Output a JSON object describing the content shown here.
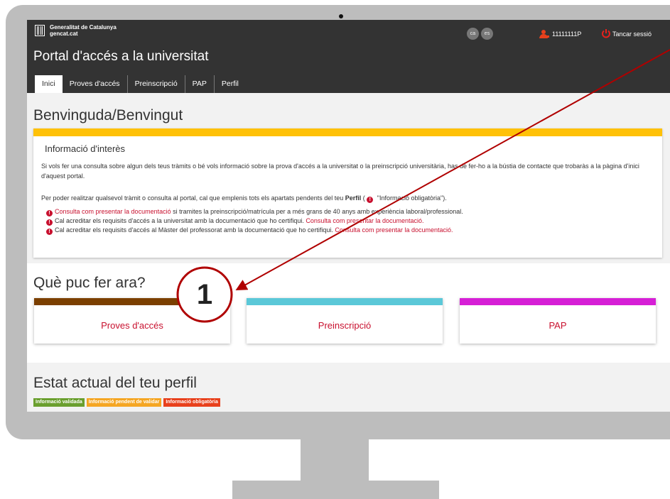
{
  "header": {
    "gov_line1": "Generalitat de Catalunya",
    "gov_line2": "gencat.cat",
    "lang_ca": "ca",
    "lang_es": "es",
    "user_id": "11111111P",
    "logout_label": "Tancar sessió",
    "portal_title": "Portal d'accés a la universitat"
  },
  "tabs": [
    {
      "label": "Inici"
    },
    {
      "label": "Proves d'accés"
    },
    {
      "label": "Preinscripció"
    },
    {
      "label": "PAP"
    },
    {
      "label": "Perfil"
    }
  ],
  "welcome_title": "Benvinguda/Benvingut",
  "info": {
    "title": "Informació d'interès",
    "para1": "Si vols fer una consulta sobre algun dels teus tràmits o bé vols informació sobre la prova d'accés a la universitat o la preinscripció universitària, has de fer-ho a la bústia de contacte que trobaràs a la pàgina d'inici d'aquest portal.",
    "para2_prefix": "Per poder realitzar qualsevol tràmit o consulta al portal, cal que emplenis tots els apartats pendents del teu ",
    "para2_bold": "Perfil",
    "para2_mid": " ( ",
    "para2_suffix": " \"Informació obligatòria\").",
    "bullet1_link": "Consulta com presentar la documentació",
    "bullet1_text": " si tramites la preinscripció/matrícula per a més grans de 40 anys amb experiència laboral/professional.",
    "bullet2_text": "Cal acreditar els requisits d'accés a la universitat amb la documentació que ho certifiqui. ",
    "bullet2_link": "Consulta com presentar la documentació.",
    "bullet3_text": "Cal acreditar els requisits d'accés al Màster del professorat amb la documentació que ho certifiqui. ",
    "bullet3_link": "Consulta com presentar la documentació."
  },
  "what_title": "Què puc fer ara?",
  "cards": [
    {
      "label": "Proves d'accés",
      "color": "#7b3f00"
    },
    {
      "label": "Preinscripció",
      "color": "#5bc8d8"
    },
    {
      "label": "PAP",
      "color": "#d61fd6"
    }
  ],
  "status_title": "Estat actual del teu perfil",
  "badges": [
    {
      "label": "Informació validada",
      "color": "#6a9f2e"
    },
    {
      "label": "Informació pendent de validar",
      "color": "#f5a623"
    },
    {
      "label": "Informació obligatòria",
      "color": "#e8401c"
    }
  ],
  "annotation": {
    "number": "1",
    "color": "#b00000"
  }
}
